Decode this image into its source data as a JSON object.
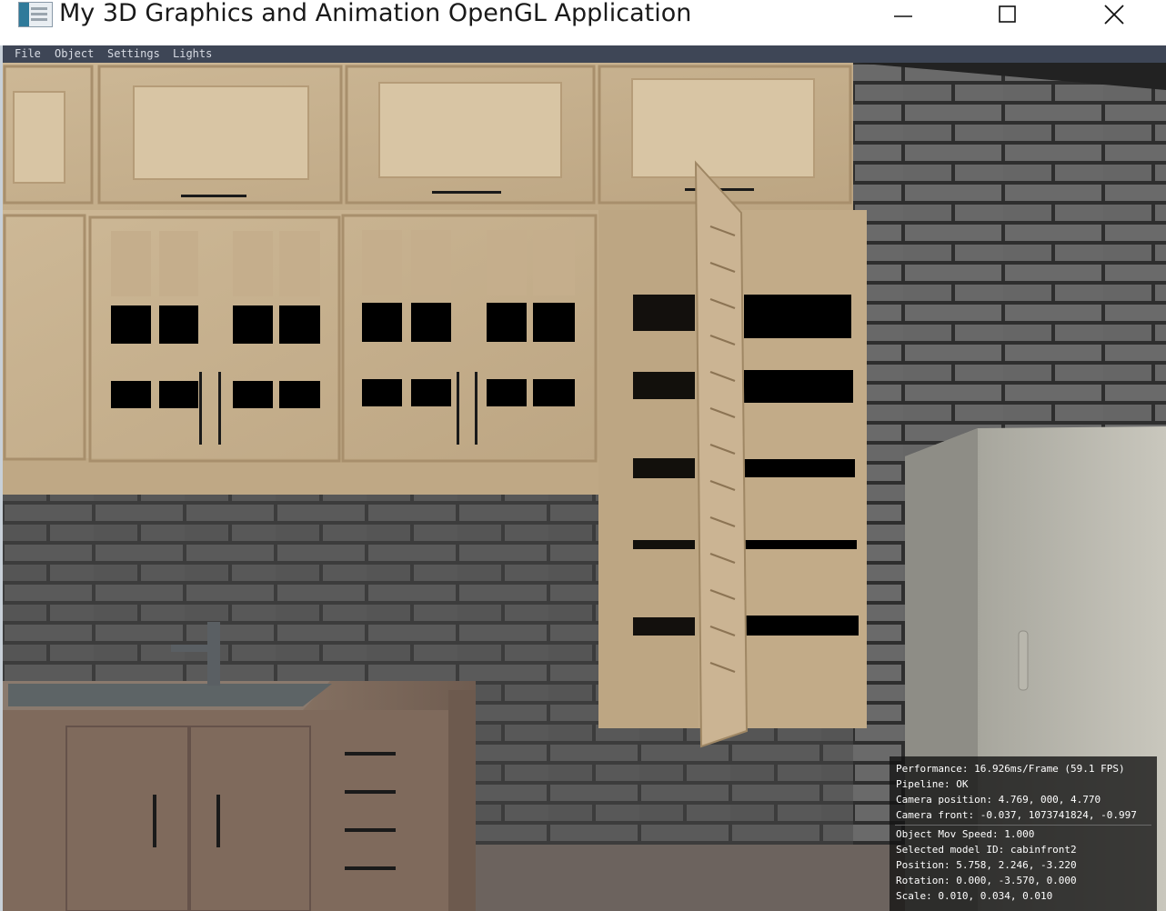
{
  "window": {
    "title": "My 3D Graphics and Animation OpenGL Application",
    "icon": "app-window-icon",
    "controls": [
      "minimize-icon",
      "maximize-icon",
      "close-icon"
    ]
  },
  "menu": {
    "items": [
      "File",
      "Object",
      "Settings",
      "Lights"
    ]
  },
  "scene": {
    "description_icon": "kitchen-3d-viewport"
  },
  "overlay": {
    "performance": "Performance: 16.926ms/Frame (59.1 FPS)",
    "pipeline": "Pipeline: OK",
    "camera_position": "Camera position: 4.769, 000, 4.770",
    "camera_front": "Camera front: -0.037, 1073741824, -0.997",
    "object_speed": "Object Mov Speed: 1.000",
    "selected_model": "Selected model ID: cabinfront2",
    "position": "Position: 5.758, 2.246, -3.220",
    "rotation": "Rotation: 0.000, -3.570, 0.000",
    "scale": "Scale: 0.010, 0.034, 0.010"
  },
  "colors": {
    "menubar": "#3e4656",
    "wood": "#d2bc9c",
    "brick": "#4a4a4a",
    "overlay_bg": "#121212"
  }
}
